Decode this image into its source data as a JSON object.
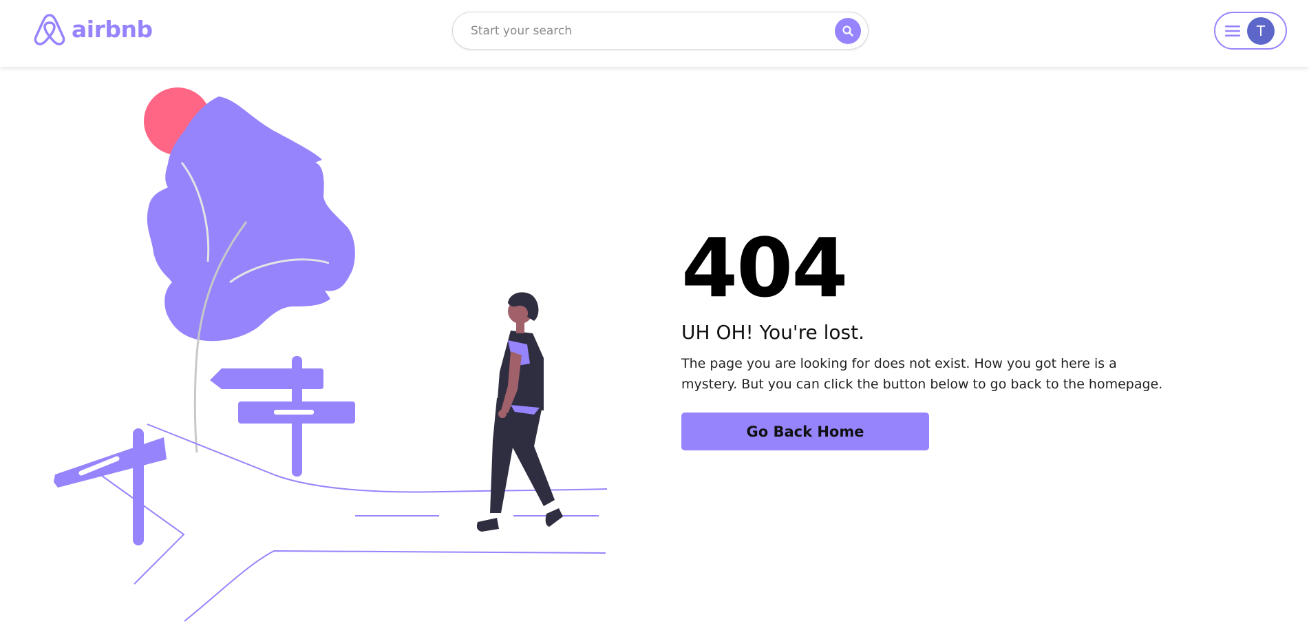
{
  "header": {
    "logo_text": "airbnb",
    "search": {
      "placeholder": "Start your search",
      "icon": "search-icon"
    },
    "menu": {
      "icon": "hamburger-menu-icon",
      "avatar_initial": "T"
    }
  },
  "error": {
    "code": "404",
    "title": "UH OH! You're lost.",
    "description": "The page you are looking for does not exist. How you got here is a mystery. But you can click the button below to go back to the homepage.",
    "button_label": "Go Back Home"
  },
  "colors": {
    "accent": "#9584fc",
    "sun": "#ff6584",
    "avatar": "#5c67c9",
    "figure_dark": "#2f2e41",
    "skin": "#a0616a"
  }
}
